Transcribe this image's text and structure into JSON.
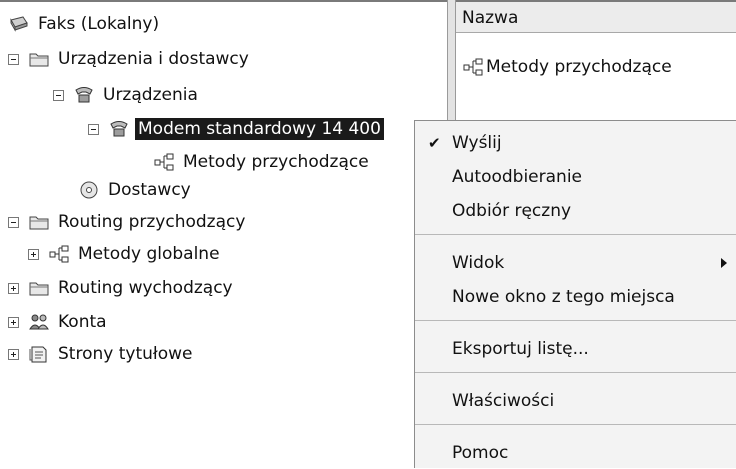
{
  "tree": {
    "items": [
      {
        "label": "Faks (Lokalny)",
        "icon": "fax-icon"
      },
      {
        "label": "Urządzenia i dostawcy",
        "icon": "folder-icon",
        "expander": "minus"
      },
      {
        "label": "Urządzenia",
        "icon": "devices-icon",
        "expander": "minus"
      },
      {
        "label": "Modem standardowy 14 400",
        "icon": "modem-icon",
        "expander": "minus",
        "selected": true
      },
      {
        "label": "Metody przychodzące",
        "icon": "method-icon"
      },
      {
        "label": "Dostawcy",
        "icon": "providers-icon"
      },
      {
        "label": "Routing przychodzący",
        "icon": "folder-icon",
        "expander": "minus"
      },
      {
        "label": "Metody globalne",
        "icon": "method-icon",
        "expander": "plus"
      },
      {
        "label": "Routing wychodzący",
        "icon": "folder-icon",
        "expander": "plus"
      },
      {
        "label": "Konta",
        "icon": "accounts-icon",
        "expander": "plus"
      },
      {
        "label": "Strony tytułowe",
        "icon": "cover-pages-icon",
        "expander": "plus"
      }
    ]
  },
  "list": {
    "column_header": "Nazwa",
    "items": [
      {
        "label": "Metody przychodzące",
        "icon": "method-icon"
      }
    ]
  },
  "context_menu": {
    "items": [
      {
        "label": "Wyślij",
        "checked": true
      },
      {
        "label": "Autoodbieranie"
      },
      {
        "label": "Odbiór ręczny"
      },
      {
        "label": "Widok",
        "submenu": true
      },
      {
        "label": "Nowe okno z tego miejsca"
      },
      {
        "label": "Eksportuj listę..."
      },
      {
        "label": "Właściwości"
      },
      {
        "label": "Pomoc"
      }
    ]
  }
}
